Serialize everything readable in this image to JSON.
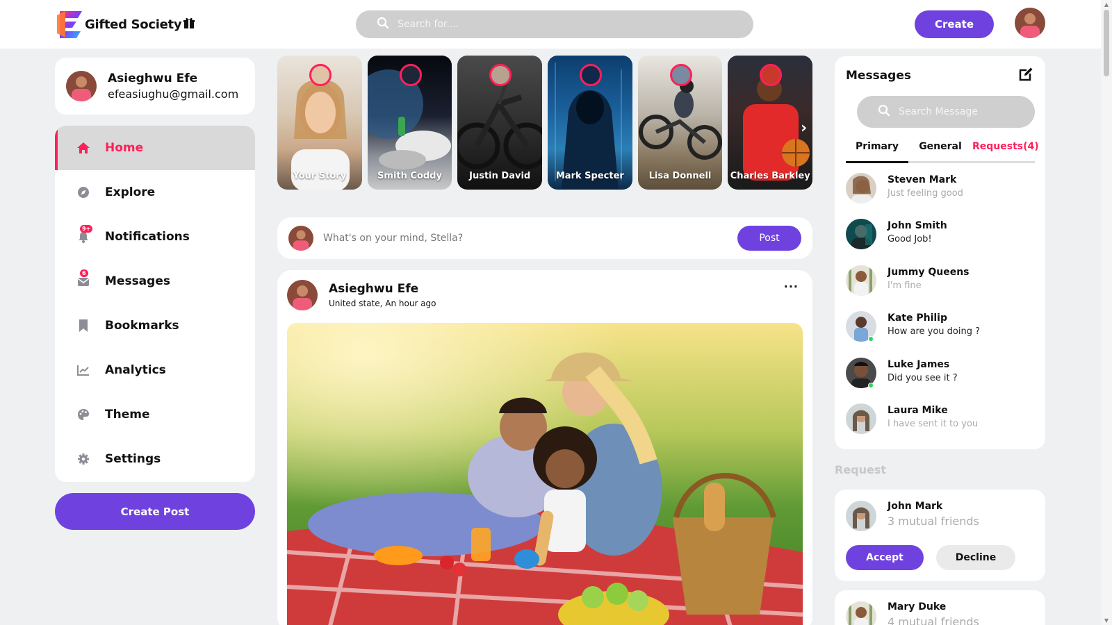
{
  "app": {
    "brand": "Gifted Society",
    "brand_colors": {
      "primary": "#6f42e0",
      "accent": "#ff1f5a"
    }
  },
  "header": {
    "search_placeholder": "Search for....",
    "create_label": "Create"
  },
  "profile": {
    "name": "Asieghwu Efe",
    "email": "efeasiughu@gmail.com"
  },
  "nav": {
    "items": [
      {
        "label": "Home",
        "icon": "home-icon",
        "active": true
      },
      {
        "label": "Explore",
        "icon": "compass-icon"
      },
      {
        "label": "Notifications",
        "icon": "bell-icon",
        "badge": "9+"
      },
      {
        "label": "Messages",
        "icon": "envelope-icon",
        "badge": "6"
      },
      {
        "label": "Bookmarks",
        "icon": "bookmark-icon"
      },
      {
        "label": "Analytics",
        "icon": "chart-line-icon"
      },
      {
        "label": "Theme",
        "icon": "palette-icon"
      },
      {
        "label": "Settings",
        "icon": "gear-icon"
      }
    ],
    "create_post_label": "Create Post"
  },
  "stories": [
    {
      "name": "Your Story"
    },
    {
      "name": "Smith Coddy"
    },
    {
      "name": "Justin David"
    },
    {
      "name": "Mark Specter"
    },
    {
      "name": "Lisa Donnell"
    },
    {
      "name": "Charles Barkley"
    }
  ],
  "compose": {
    "placeholder": "What's on your mind, Stella?",
    "post_label": "Post"
  },
  "post": {
    "author": "Asieghwu Efe",
    "meta": "United state, An hour ago",
    "more": "···"
  },
  "messages": {
    "title": "Messages",
    "search_placeholder": "Search Message",
    "tabs": {
      "primary": "Primary",
      "general": "General",
      "requests": "Requests(4)"
    },
    "items": [
      {
        "name": "Steven Mark",
        "preview": "Just feeling good"
      },
      {
        "name": "John Smith",
        "preview": "Good Job!"
      },
      {
        "name": "Jummy Queens",
        "preview": "I'm fine"
      },
      {
        "name": "Kate Philip",
        "preview": "How are you doing ?"
      },
      {
        "name": "Luke James",
        "preview": "Did you see it ?"
      },
      {
        "name": "Laura Mike",
        "preview": "I have sent it to you"
      }
    ]
  },
  "requests": {
    "title": "Request",
    "items": [
      {
        "name": "John Mark",
        "mutual": "3 mutual friends",
        "accept": "Accept",
        "decline": "Decline"
      },
      {
        "name": "Mary Duke",
        "mutual": "4 mutual friends"
      }
    ]
  }
}
